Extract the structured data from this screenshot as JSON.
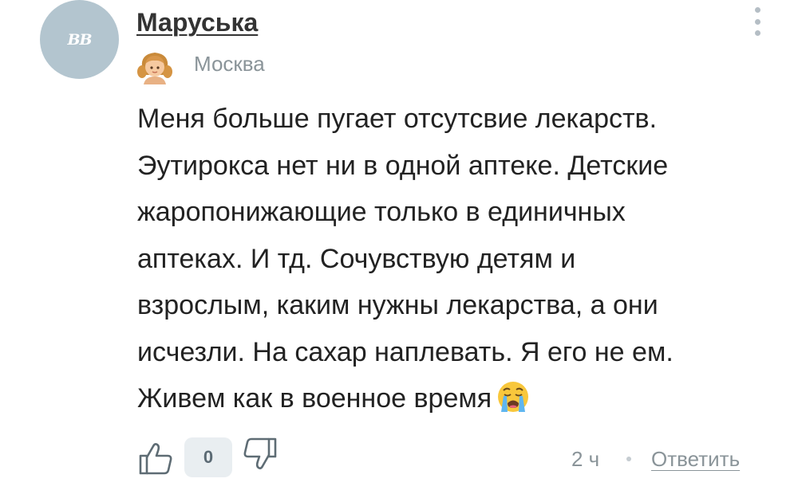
{
  "comment": {
    "author": {
      "avatar_initials": "ВВ",
      "name": "Маруська",
      "location": "Москва"
    },
    "text_lines": [
      "Меня больше пугает отсутсвие лекарств.",
      "Эутирокса нет ни в одной аптеке. Детские",
      "жаропонижающие только в единичных",
      "аптеках. И тд. Сочувствую детям и",
      "взрослым, каким нужны лекарства, а они",
      "исчезли. На сахар наплевать. Я его не ем.",
      "Живем как в военное время"
    ],
    "emoji": "crying-face",
    "vote_count": "0",
    "timestamp": "2 ч",
    "reply_label": "Ответить"
  },
  "icons": {
    "menu": "more-vertical-icon",
    "like": "thumbs-up-icon",
    "dislike": "thumbs-down-icon",
    "badge": "girl-avatar-icon"
  },
  "colors": {
    "avatar_bg": "#b3c5cf",
    "muted_text": "#8a9499",
    "vote_bg": "#e9eef1",
    "icon_stroke": "#5e6c74"
  }
}
